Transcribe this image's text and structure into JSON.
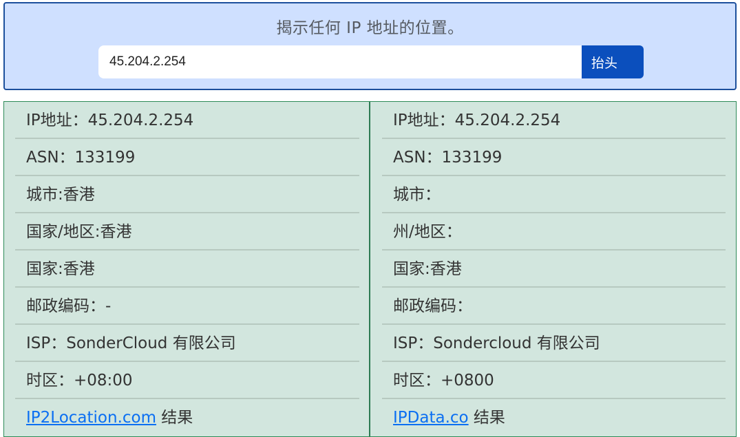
{
  "search": {
    "title": "揭示任何 IP 地址的位置。",
    "ip_value": "45.204.2.254",
    "button_label": "抬头"
  },
  "results": {
    "left": {
      "ip": "IP地址：45.204.2.254",
      "asn": "ASN：133199",
      "city": "城市:香港",
      "region": "国家/地区:香港",
      "country": "国家:香港",
      "postal": "邮政编码：-",
      "isp": "ISP：SonderCloud 有限公司",
      "timezone": "时区：+08:00",
      "source_link": "IP2Location.com",
      "source_suffix": " 结果"
    },
    "right": {
      "ip": "IP地址：45.204.2.254",
      "asn": "ASN：133199",
      "city": "城市：",
      "region": "州/地区：",
      "country": "国家:香港",
      "postal": "邮政编码：",
      "isp": "ISP：Sondercloud 有限公司",
      "timezone": "时区：+0800",
      "source_link": "IPData.co",
      "source_suffix": " 结果"
    }
  }
}
